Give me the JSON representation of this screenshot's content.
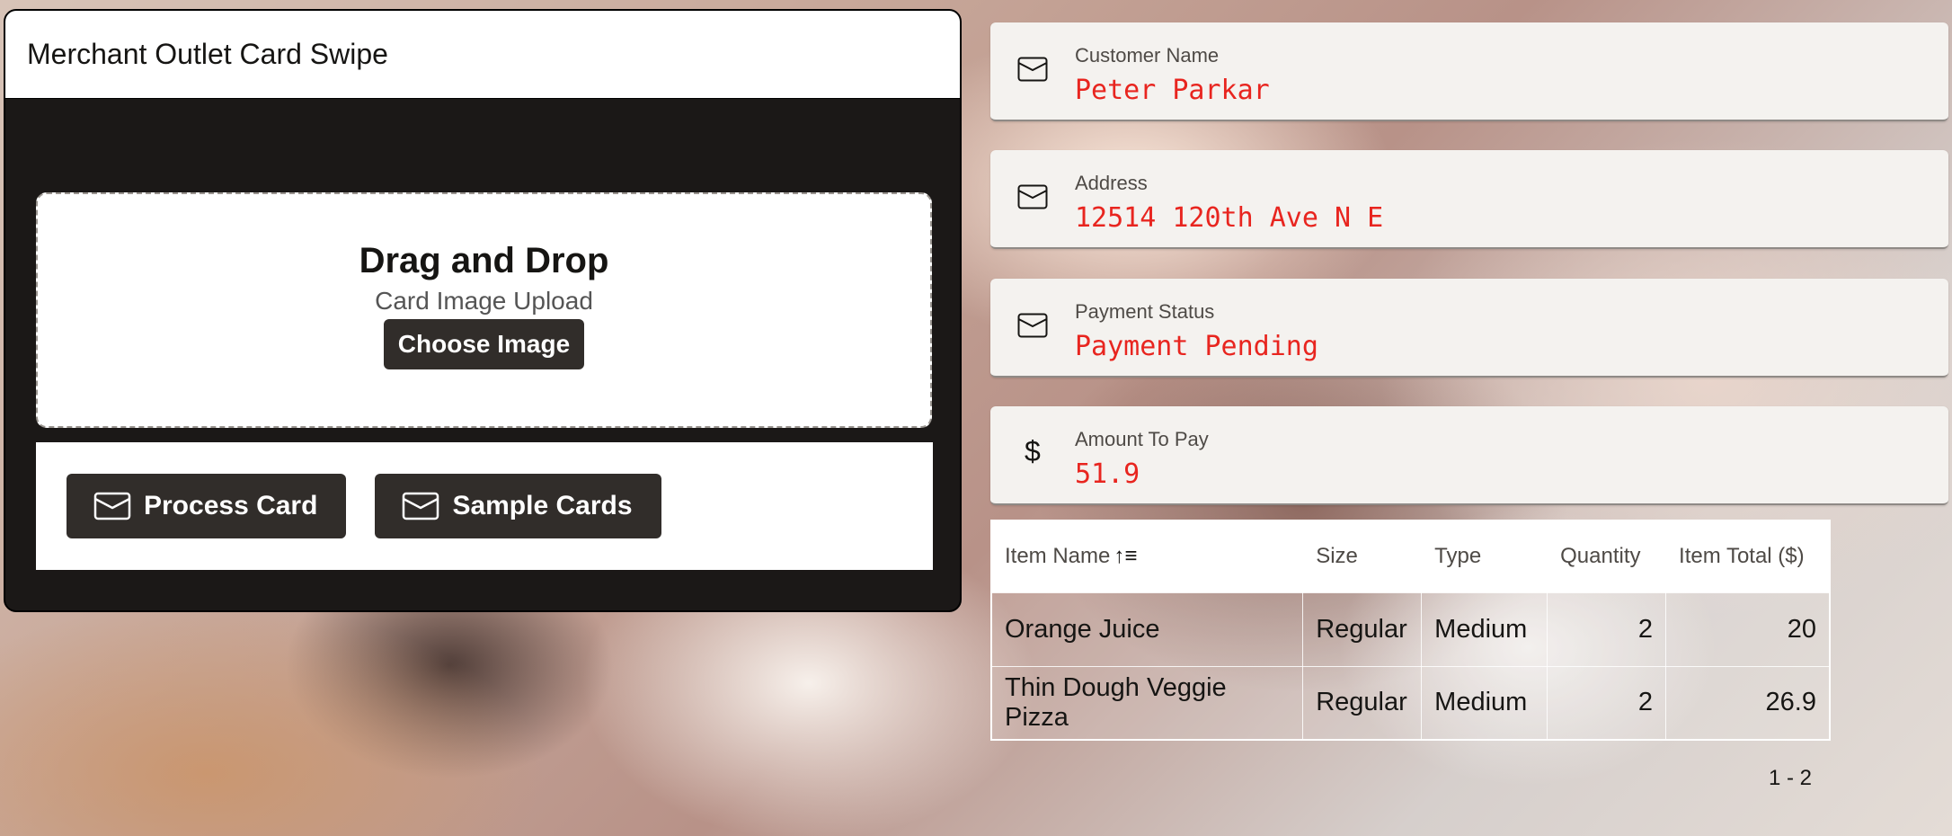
{
  "merchant": {
    "title": "Merchant Outlet Card Swipe",
    "dropzone": {
      "title": "Drag and Drop",
      "subtitle": "Card Image Upload",
      "choose_label": "Choose Image"
    },
    "actions": {
      "process_label": "Process Card",
      "sample_label": "Sample Cards"
    }
  },
  "fields": [
    {
      "label": "Customer Name",
      "value": "Peter Parkar",
      "icon": "card-icon"
    },
    {
      "label": "Address",
      "value": "12514 120th Ave N E",
      "icon": "card-icon"
    },
    {
      "label": "Payment Status",
      "value": "Payment Pending",
      "icon": "card-icon"
    },
    {
      "label": "Amount To Pay",
      "value": "51.9",
      "icon": "dollar-icon",
      "icon_glyph": "$"
    }
  ],
  "table": {
    "headers": [
      "Item Name",
      "Size",
      "Type",
      "Quantity",
      "Item Total ($)"
    ],
    "sort_icon": "↑≡",
    "rows": [
      [
        "Orange Juice",
        "Regular",
        "Medium",
        "2",
        "20"
      ],
      [
        "Thin Dough Veggie Pizza",
        "Regular",
        "Medium",
        "2",
        "26.9"
      ]
    ],
    "pagination": "1 - 2"
  },
  "colors": {
    "value_text": "#e8251f",
    "dark_button": "#312d2a",
    "panel_dark": "#1b1817"
  }
}
